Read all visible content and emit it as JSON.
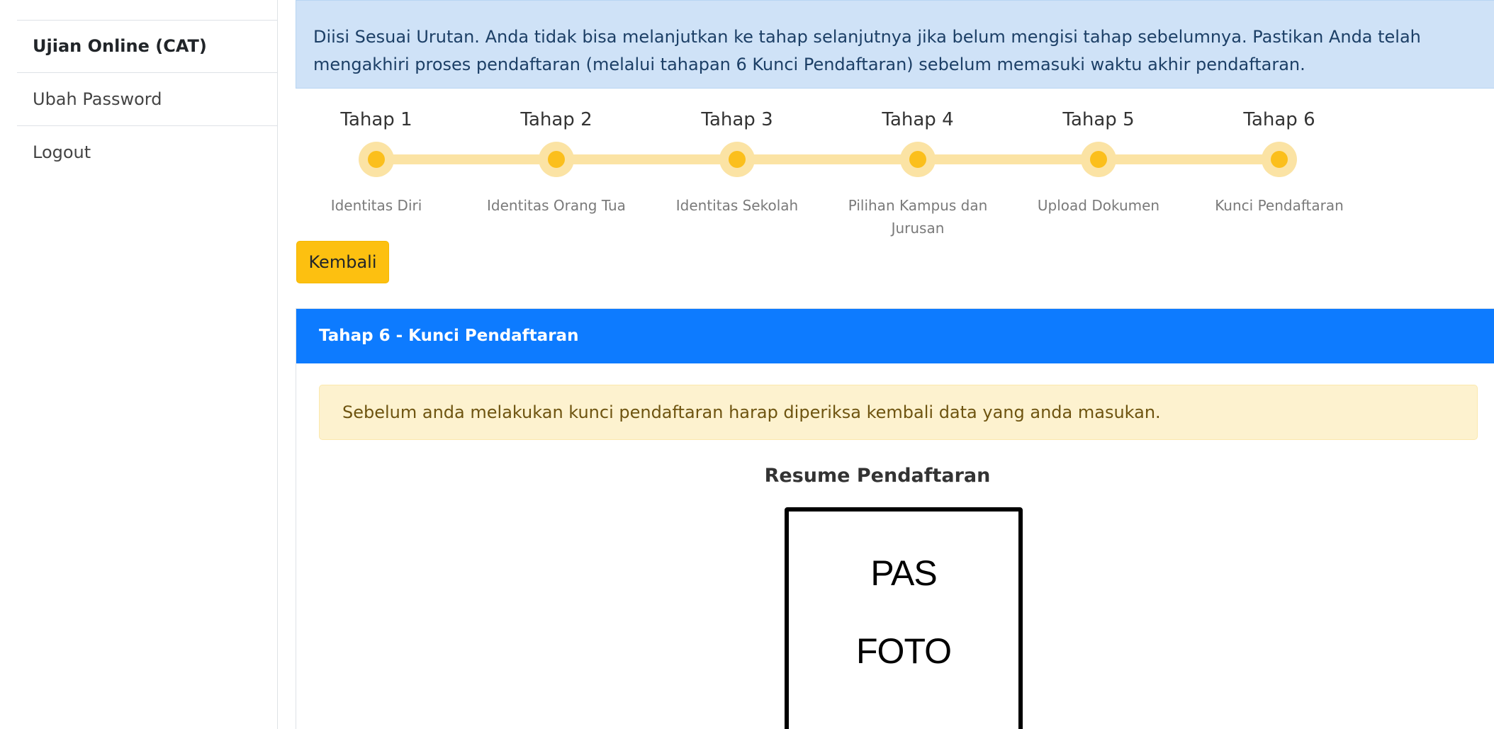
{
  "sidebar": {
    "items": [
      {
        "label": "Ujian Online (CAT)",
        "active": true
      },
      {
        "label": "Ubah Password",
        "active": false
      },
      {
        "label": "Logout",
        "active": false
      }
    ]
  },
  "info_alert": {
    "text": "Diisi Sesuai Urutan. Anda tidak bisa melanjutkan ke tahap selanjutnya jika belum mengisi tahap sebelumnya. Pastikan Anda telah mengakhiri proses pendaftaran (melalui tahapan 6 Kunci Pendaftaran) sebelum memasuki waktu akhir pendaftaran."
  },
  "stepper": {
    "steps": [
      {
        "title": "Tahap 1",
        "subtitle": "Identitas Diri"
      },
      {
        "title": "Tahap 2",
        "subtitle": "Identitas Orang Tua"
      },
      {
        "title": "Tahap 3",
        "subtitle": "Identitas Sekolah"
      },
      {
        "title": "Tahap 4",
        "subtitle": "Pilihan Kampus dan Jurusan"
      },
      {
        "title": "Tahap 5",
        "subtitle": "Upload Dokumen"
      },
      {
        "title": "Tahap 6",
        "subtitle": "Kunci Pendaftaran"
      }
    ]
  },
  "actions": {
    "back_label": "Kembali"
  },
  "card": {
    "header": "Tahap 6 - Kunci Pendaftaran",
    "warning": "Sebelum anda melakukan kunci pendaftaran harap diperiksa kembali data yang anda masukan.",
    "resume_title": "Resume Pendaftaran",
    "photo_placeholder": {
      "line1": "PAS",
      "line2": "FOTO"
    }
  },
  "colors": {
    "info_bg": "#cfe2f7",
    "primary": "#0d7bff",
    "warning_btn": "#fdc010",
    "warning_alert_bg": "#fdf2cf",
    "step_dot": "#fbbf1c",
    "step_track": "#fbe3a4"
  }
}
